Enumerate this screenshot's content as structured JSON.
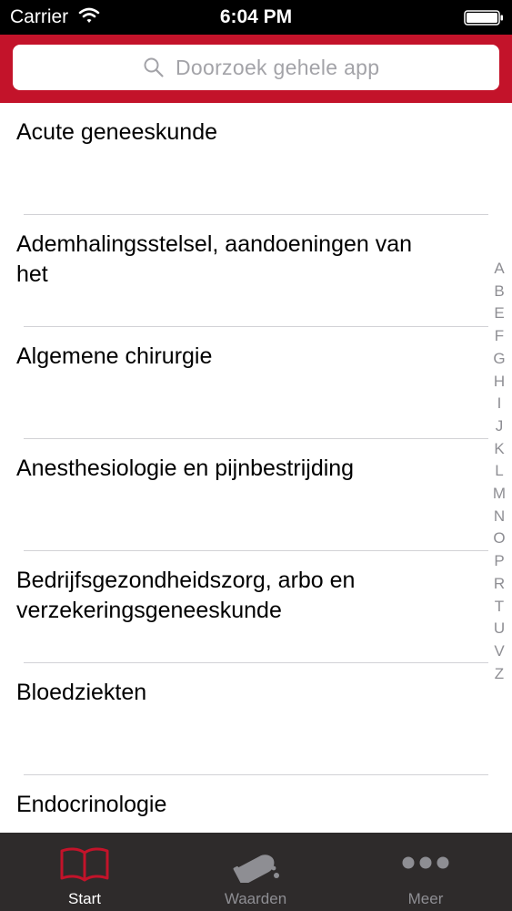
{
  "status_bar": {
    "carrier": "Carrier",
    "time": "6:04 PM"
  },
  "search": {
    "placeholder": "Doorzoek gehele app"
  },
  "list": {
    "items": [
      {
        "label": "Acute geneeskunde"
      },
      {
        "label": "Ademhalingsstelsel, aandoeningen van het"
      },
      {
        "label": "Algemene chirurgie"
      },
      {
        "label": "Anesthesiologie en pijnbestrijding"
      },
      {
        "label": "Bedrijfsgezondheidszorg, arbo en verzekeringsgeneeskunde"
      },
      {
        "label": "Bloedziekten"
      },
      {
        "label": "Endocrinologie"
      }
    ]
  },
  "index": {
    "letters": [
      "A",
      "B",
      "E",
      "F",
      "G",
      "H",
      "I",
      "J",
      "K",
      "L",
      "M",
      "N",
      "O",
      "P",
      "R",
      "T",
      "U",
      "V",
      "Z"
    ]
  },
  "tabs": {
    "start": {
      "label": "Start",
      "icon": "book-icon"
    },
    "waarden": {
      "label": "Waarden",
      "icon": "flask-icon"
    },
    "meer": {
      "label": "Meer",
      "icon": "more-dots-icon"
    }
  },
  "colors": {
    "brand": "#c3132a",
    "tab_bar": "#2e2b2b",
    "active_icon": "#c3132a",
    "inactive": "#8e8e93"
  }
}
